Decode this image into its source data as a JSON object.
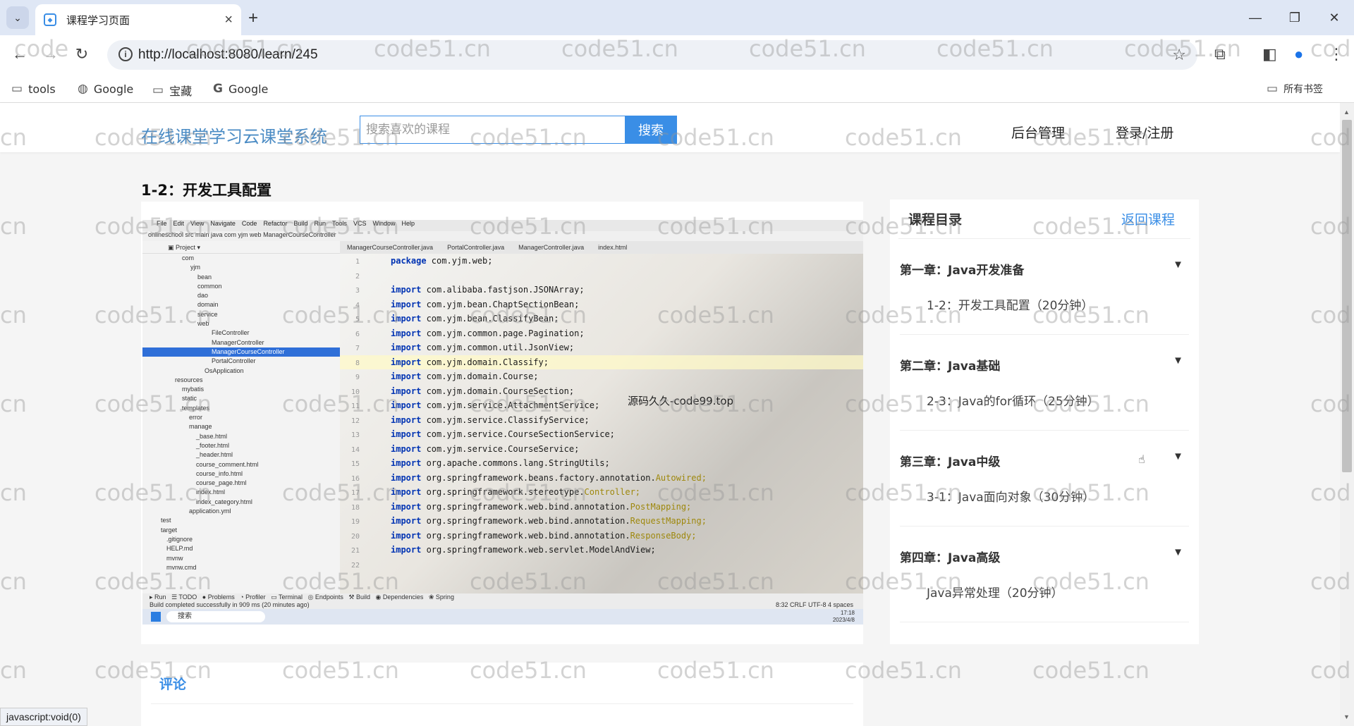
{
  "browser": {
    "tab_title": "课程学习页面",
    "url": "http://localhost:8080/learn/245",
    "bookmarks": [
      {
        "label": "tools",
        "icon": "folder-icon"
      },
      {
        "label": "Google",
        "icon": "globe-icon"
      },
      {
        "label": "宝藏",
        "icon": "folder-icon"
      },
      {
        "label": "Google",
        "icon": "google-g-icon"
      }
    ],
    "all_bookmarks": "所有书签",
    "status_link": "javascript:void(0)"
  },
  "site": {
    "logo": "在线课堂学习云课堂系统",
    "search_placeholder": "搜索喜欢的课程",
    "search_button": "搜索",
    "nav": [
      "后台管理",
      "登录/注册"
    ]
  },
  "lesson": {
    "title": "1-2：开发工具配置"
  },
  "video": {
    "ide_menu": [
      "File",
      "Edit",
      "View",
      "Navigate",
      "Code",
      "Refactor",
      "Build",
      "Run",
      "Tools",
      "VCS",
      "Window",
      "Help"
    ],
    "ide_path": "onlineschool  src  main  java  com  yjm  web  ManagerCourseController",
    "editor_tabs": [
      "ManagerCourseController.java",
      "PortalController.java",
      "ManagerController.java",
      "index.html"
    ],
    "project_tree": [
      "com",
      "yjm",
      "bean",
      "common",
      "dao",
      "domain",
      "service",
      "web",
      "FileController",
      "ManagerController",
      "ManagerCourseController",
      "PortalController",
      "OsApplication",
      "resources",
      "mybatis",
      "static",
      "templates",
      "error",
      "manage",
      "_base.html",
      "_footer.html",
      "_header.html",
      "course_comment.html",
      "course_info.html",
      "course_page.html",
      "index.html",
      "index_category.html",
      "application.yml",
      "test",
      "target",
      ".gitignore",
      "HELP.md",
      "mvnw",
      "mvnw.cmd"
    ],
    "code_lines": [
      {
        "no": "1",
        "kw": "package",
        "rest": " com.yjm.web;",
        "ann": ""
      },
      {
        "no": "2",
        "kw": "",
        "rest": "",
        "ann": ""
      },
      {
        "no": "3",
        "kw": "import",
        "rest": " com.alibaba.fastjson.JSONArray;",
        "ann": ""
      },
      {
        "no": "4",
        "kw": "import",
        "rest": " com.yjm.bean.ChaptSectionBean;",
        "ann": ""
      },
      {
        "no": "5",
        "kw": "import",
        "rest": " com.yjm.bean.ClassifyBean;",
        "ann": ""
      },
      {
        "no": "6",
        "kw": "import",
        "rest": " com.yjm.common.page.Pagination;",
        "ann": ""
      },
      {
        "no": "7",
        "kw": "import",
        "rest": " com.yjm.common.util.JsonView;",
        "ann": ""
      },
      {
        "no": "8",
        "kw": "import",
        "rest": " com.yjm.domain.Classify;",
        "ann": ""
      },
      {
        "no": "9",
        "kw": "import",
        "rest": " com.yjm.domain.Course;",
        "ann": ""
      },
      {
        "no": "10",
        "kw": "import",
        "rest": " com.yjm.domain.CourseSection;",
        "ann": ""
      },
      {
        "no": "11",
        "kw": "import",
        "rest": " com.yjm.service.AttachmentService;",
        "ann": ""
      },
      {
        "no": "12",
        "kw": "import",
        "rest": " com.yjm.service.ClassifyService;",
        "ann": ""
      },
      {
        "no": "13",
        "kw": "import",
        "rest": " com.yjm.service.CourseSectionService;",
        "ann": ""
      },
      {
        "no": "14",
        "kw": "import",
        "rest": " com.yjm.service.CourseService;",
        "ann": ""
      },
      {
        "no": "15",
        "kw": "import",
        "rest": " org.apache.commons.lang.StringUtils;",
        "ann": ""
      },
      {
        "no": "16",
        "kw": "import",
        "rest": " org.springframework.beans.factory.annotation.",
        "ann": "Autowired;"
      },
      {
        "no": "17",
        "kw": "import",
        "rest": " org.springframework.stereotype.",
        "ann": "Controller;"
      },
      {
        "no": "18",
        "kw": "import",
        "rest": " org.springframework.web.bind.annotation.",
        "ann": "PostMapping;"
      },
      {
        "no": "19",
        "kw": "import",
        "rest": " org.springframework.web.bind.annotation.",
        "ann": "RequestMapping;"
      },
      {
        "no": "20",
        "kw": "import",
        "rest": " org.springframework.web.bind.annotation.",
        "ann": "ResponseBody;"
      },
      {
        "no": "21",
        "kw": "import",
        "rest": " org.springframework.web.servlet.ModelAndView;",
        "ann": ""
      },
      {
        "no": "22",
        "kw": "",
        "rest": "",
        "ann": ""
      }
    ],
    "overlay_text": "源码久久-code99.top",
    "build_status": "Build completed successfully in 909 ms (20 minutes ago)",
    "cursor_info": "8:32  CRLF  UTF-8  4 spaces",
    "taskbar_search": "搜索",
    "taskbar_time": "17:18",
    "taskbar_date": "2023/4/8"
  },
  "catalog": {
    "title": "课程目录",
    "back_link": "返回课程",
    "chapters": [
      {
        "title": "第一章：Java开发准备",
        "section": "1-2：开发工具配置（20分钟）"
      },
      {
        "title": "第二章：Java基础",
        "section": "2-3：Java的for循环（25分钟）"
      },
      {
        "title": "第三章：Java中级",
        "section": "3-1：Java面向对象（30分钟）"
      },
      {
        "title": "第四章：Java高级",
        "section": "Java异常处理（20分钟）"
      }
    ],
    "arrow_glyph": "▼"
  },
  "comments": {
    "title": "评论"
  },
  "watermark": {
    "text_full": "code51.cn",
    "text_partial": "cn",
    "text_left": "code",
    "text_right": "cod"
  }
}
